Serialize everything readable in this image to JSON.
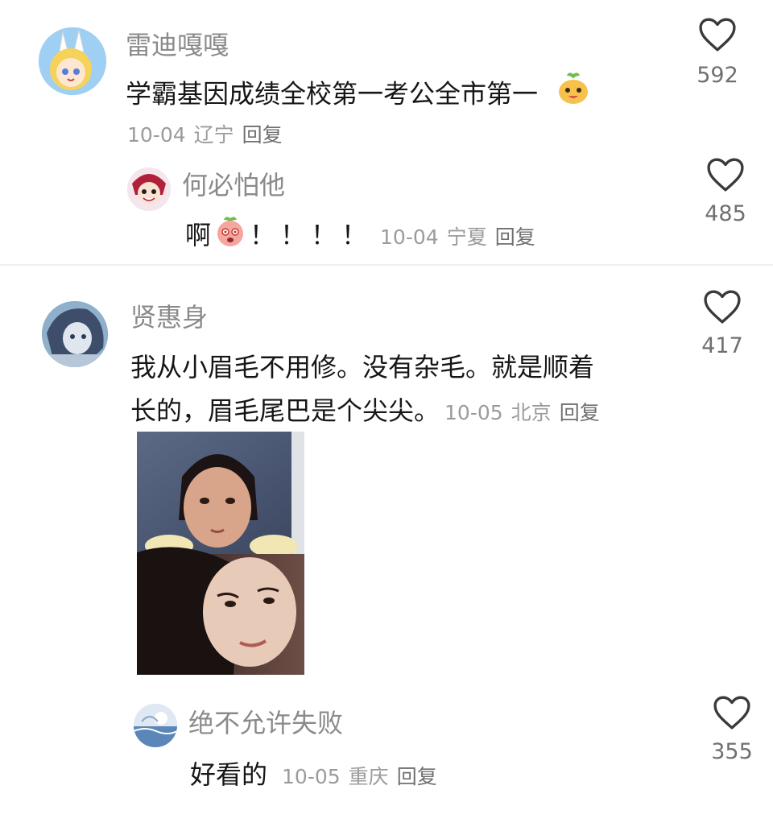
{
  "comments": [
    {
      "user": "雷迪嘎嘎",
      "text": "学霸基因成绩全校第一考公全市第一",
      "date": "10-04",
      "location": "辽宁",
      "reply_label": "回复",
      "likes": "592",
      "avatar_icon": "anime-girl-bunny-avatar",
      "trailing_emoji": "smiling-sprout-emoji",
      "replies": [
        {
          "user": "何必怕他",
          "text_prefix": "啊",
          "text_suffix": "！！！！",
          "emoji": "shocked-peach-emoji",
          "date": "10-04",
          "location": "宁夏",
          "reply_label": "回复",
          "likes": "485",
          "avatar_icon": "anime-character-avatar"
        }
      ]
    },
    {
      "user": "贤惠身",
      "text_line1": "我从小眉毛不用修。没有杂毛。就是顺着",
      "text_line2": "长的，眉毛尾巴是个尖尖。",
      "date": "10-05",
      "location": "北京",
      "reply_label": "回复",
      "likes": "417",
      "avatar_icon": "anime-girl-blue-avatar",
      "attached_image": "childhood-and-adult-photo-collage",
      "replies": [
        {
          "user": "绝不允许失败",
          "text": "好看的",
          "date": "10-05",
          "location": "重庆",
          "reply_label": "回复",
          "likes": "355",
          "avatar_icon": "ocean-scene-avatar"
        }
      ]
    }
  ],
  "colors": {
    "username": "#8a8a8a",
    "text": "#161616",
    "meta": "#9b9b9b",
    "divider": "#f0f0f0"
  }
}
